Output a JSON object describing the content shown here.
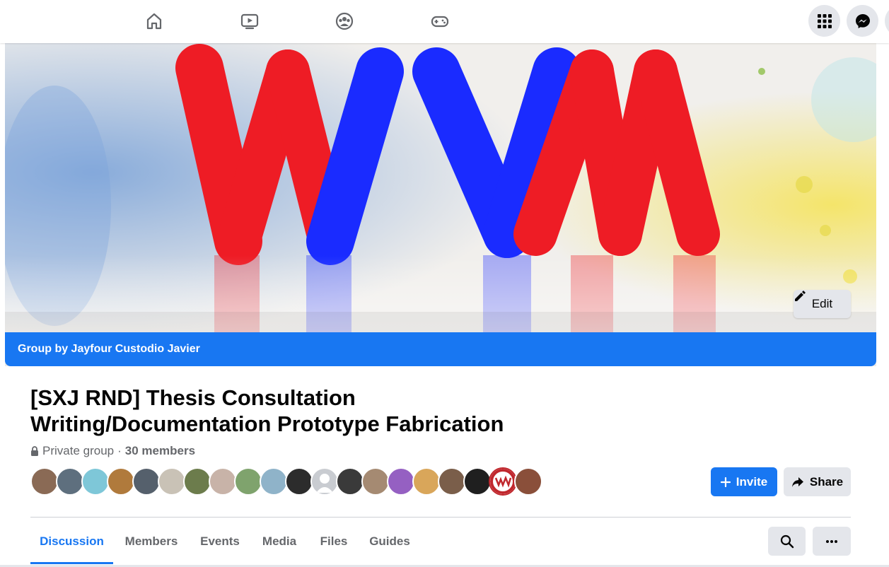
{
  "topnav": {
    "icons": [
      "home-icon",
      "watch-icon",
      "groups-icon",
      "gaming-icon"
    ],
    "right_icons": [
      "menu-grid-icon",
      "messenger-icon"
    ]
  },
  "cover": {
    "logo_text": "WVM",
    "edit_label": "Edit"
  },
  "group": {
    "by_line": "Group by Jayfour Custodio Javier",
    "title_line1": "[SXJ RND] Thesis Consultation",
    "title_line2": "Writing/Documentation Prototype Fabrication",
    "privacy": "Private group",
    "separator": "·",
    "members_count": "30 members"
  },
  "actions": {
    "invite_label": "Invite",
    "share_label": "Share"
  },
  "tabs": [
    {
      "label": "Discussion",
      "active": true
    },
    {
      "label": "Members",
      "active": false
    },
    {
      "label": "Events",
      "active": false
    },
    {
      "label": "Media",
      "active": false
    },
    {
      "label": "Files",
      "active": false
    },
    {
      "label": "Guides",
      "active": false
    }
  ],
  "colors": {
    "accent": "#1877f2",
    "logo_red": "#ee1c25",
    "logo_blue": "#1a2bff"
  }
}
